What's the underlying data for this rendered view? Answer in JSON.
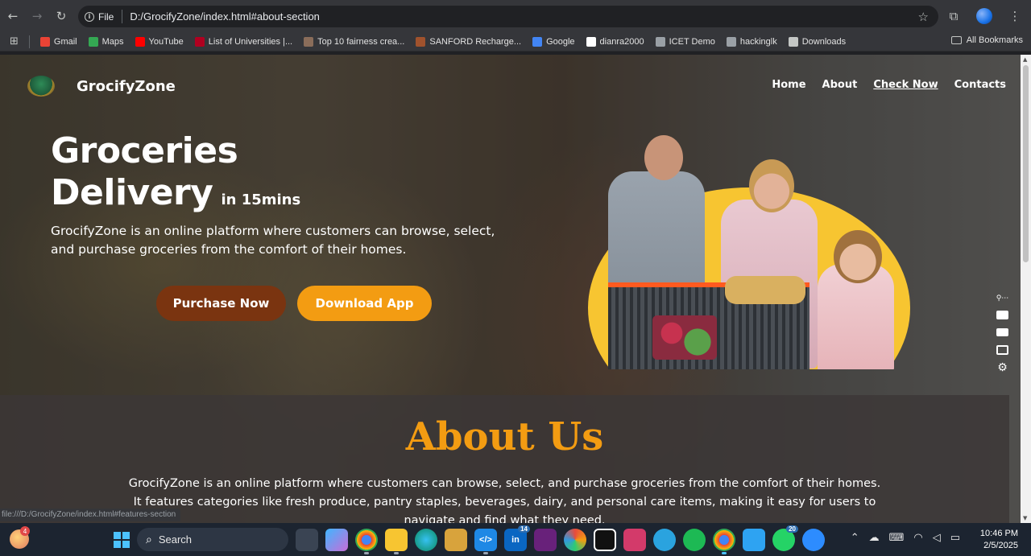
{
  "browser": {
    "url_scheme_label": "File",
    "url": "D:/GrocifyZone/index.html#about-section",
    "status_url": "file:///D:/GrocifyZone/index.html#features-section"
  },
  "bookmarks": [
    {
      "label": "Gmail",
      "icon": "gmail-icon",
      "color": "#ea4335"
    },
    {
      "label": "Maps",
      "icon": "maps-icon",
      "color": "#34a853"
    },
    {
      "label": "YouTube",
      "icon": "youtube-icon",
      "color": "#ff0000"
    },
    {
      "label": "List of Universities |...",
      "icon": "university-icon",
      "color": "#b00020"
    },
    {
      "label": "Top 10 fairness crea...",
      "icon": "site-icon",
      "color": "#8a6d5a"
    },
    {
      "label": "SANFORD Recharge...",
      "icon": "site-icon",
      "color": "#a0522d"
    },
    {
      "label": "Google",
      "icon": "google-icon",
      "color": "#4285f4"
    },
    {
      "label": "dianra2000",
      "icon": "github-icon",
      "color": "#ffffff"
    },
    {
      "label": "ICET Demo",
      "icon": "globe-icon",
      "color": "#9aa0a6"
    },
    {
      "label": "hackinglk",
      "icon": "globe-icon",
      "color": "#9aa0a6"
    },
    {
      "label": "Downloads",
      "icon": "download-icon",
      "color": "#c4c7c5"
    }
  ],
  "all_bookmarks_label": "All Bookmarks",
  "site": {
    "brand": "GrocifyZone",
    "nav": [
      "Home",
      "About",
      "Check Now",
      "Contacts"
    ],
    "headline_line1": "Groceries",
    "headline_line2": "Delivery",
    "headline_small": "in 15mins",
    "description": "GrocifyZone is an online platform where customers can browse, select, and purchase groceries from the comfort of their homes.",
    "purchase_button": "Purchase Now",
    "download_button": "Download App",
    "about_title": "About Us",
    "about_line1": "GrocifyZone is an online platform where customers can browse, select, and purchase groceries from the comfort of their homes.",
    "about_line2": "It features categories like fresh produce, pantry staples, beverages, dairy, and personal care items, making it easy for users to",
    "about_line3": "navigate and find what they need."
  },
  "colors": {
    "accent_orange": "#f39c12",
    "purchase_brown": "#7a3410",
    "illustration_yellow": "#f7c531"
  },
  "taskbar": {
    "search_label": "Search",
    "weather_badge": "4",
    "linkedin_badge": "14",
    "whatsapp_badge": "20",
    "time": "10:46 PM",
    "date": "2/5/2025"
  }
}
